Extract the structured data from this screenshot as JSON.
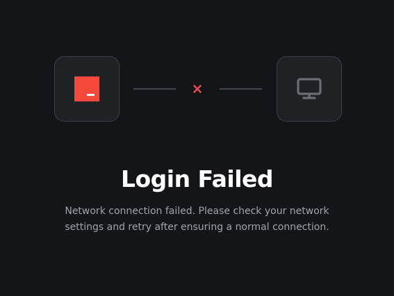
{
  "title": "Login Failed",
  "message": "Network connection failed. Please check your network settings and retry after ensuring a normal connection.",
  "icons": {
    "left": "terminal-app-icon",
    "status": "close-icon",
    "right": "monitor-icon"
  },
  "colors": {
    "background": "#141519",
    "tile": "#202125",
    "accent": "#f4493a",
    "error": "#e24b4f",
    "muted": "#a2a3a8"
  }
}
